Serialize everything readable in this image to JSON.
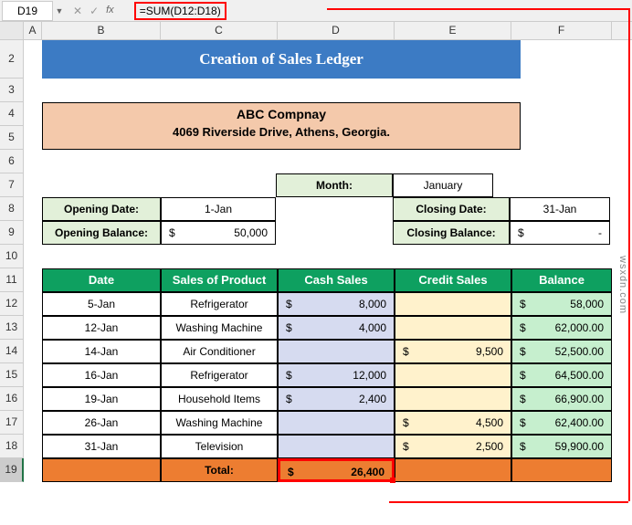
{
  "nameBox": "D19",
  "formula": "=SUM(D12:D18)",
  "columns": [
    "A",
    "B",
    "C",
    "D",
    "E",
    "F"
  ],
  "rows": [
    "2",
    "3",
    "4",
    "5",
    "6",
    "7",
    "8",
    "9",
    "10",
    "11",
    "12",
    "13",
    "14",
    "15",
    "16",
    "17",
    "18",
    "19"
  ],
  "title": "Creation of Sales Ledger",
  "company": {
    "name": "ABC Compnay",
    "address": "4069 Riverside Drive, Athens, Georgia."
  },
  "info": {
    "monthLabel": "Month:",
    "month": "January",
    "openDateLabel": "Opening Date:",
    "openDate": "1-Jan",
    "closeDateLabel": "Closing Date:",
    "closeDate": "31-Jan",
    "openBalLabel": "Opening Balance:",
    "openBal": "50,000",
    "closeBalLabel": "Closing Balance:",
    "closeBal": "-"
  },
  "headers": {
    "date": "Date",
    "product": "Sales of Product",
    "cash": "Cash Sales",
    "credit": "Credit Sales",
    "balance": "Balance"
  },
  "table": [
    {
      "date": "5-Jan",
      "product": "Refrigerator",
      "cash": "8,000",
      "credit": "",
      "balance": "58,000"
    },
    {
      "date": "12-Jan",
      "product": "Washing Machine",
      "cash": "4,000",
      "credit": "",
      "balance": "62,000.00"
    },
    {
      "date": "14-Jan",
      "product": "Air Conditioner",
      "cash": "",
      "credit": "9,500",
      "balance": "52,500.00"
    },
    {
      "date": "16-Jan",
      "product": "Refrigerator",
      "cash": "12,000",
      "credit": "",
      "balance": "64,500.00"
    },
    {
      "date": "19-Jan",
      "product": "Household Items",
      "cash": "2,400",
      "credit": "",
      "balance": "66,900.00"
    },
    {
      "date": "26-Jan",
      "product": "Washing Machine",
      "cash": "",
      "credit": "4,500",
      "balance": "62,400.00"
    },
    {
      "date": "31-Jan",
      "product": "Television",
      "cash": "",
      "credit": "2,500",
      "balance": "59,900.00"
    }
  ],
  "total": {
    "label": "Total:",
    "cash": "26,400"
  },
  "currency": "$",
  "watermark": "wsxdn.com"
}
